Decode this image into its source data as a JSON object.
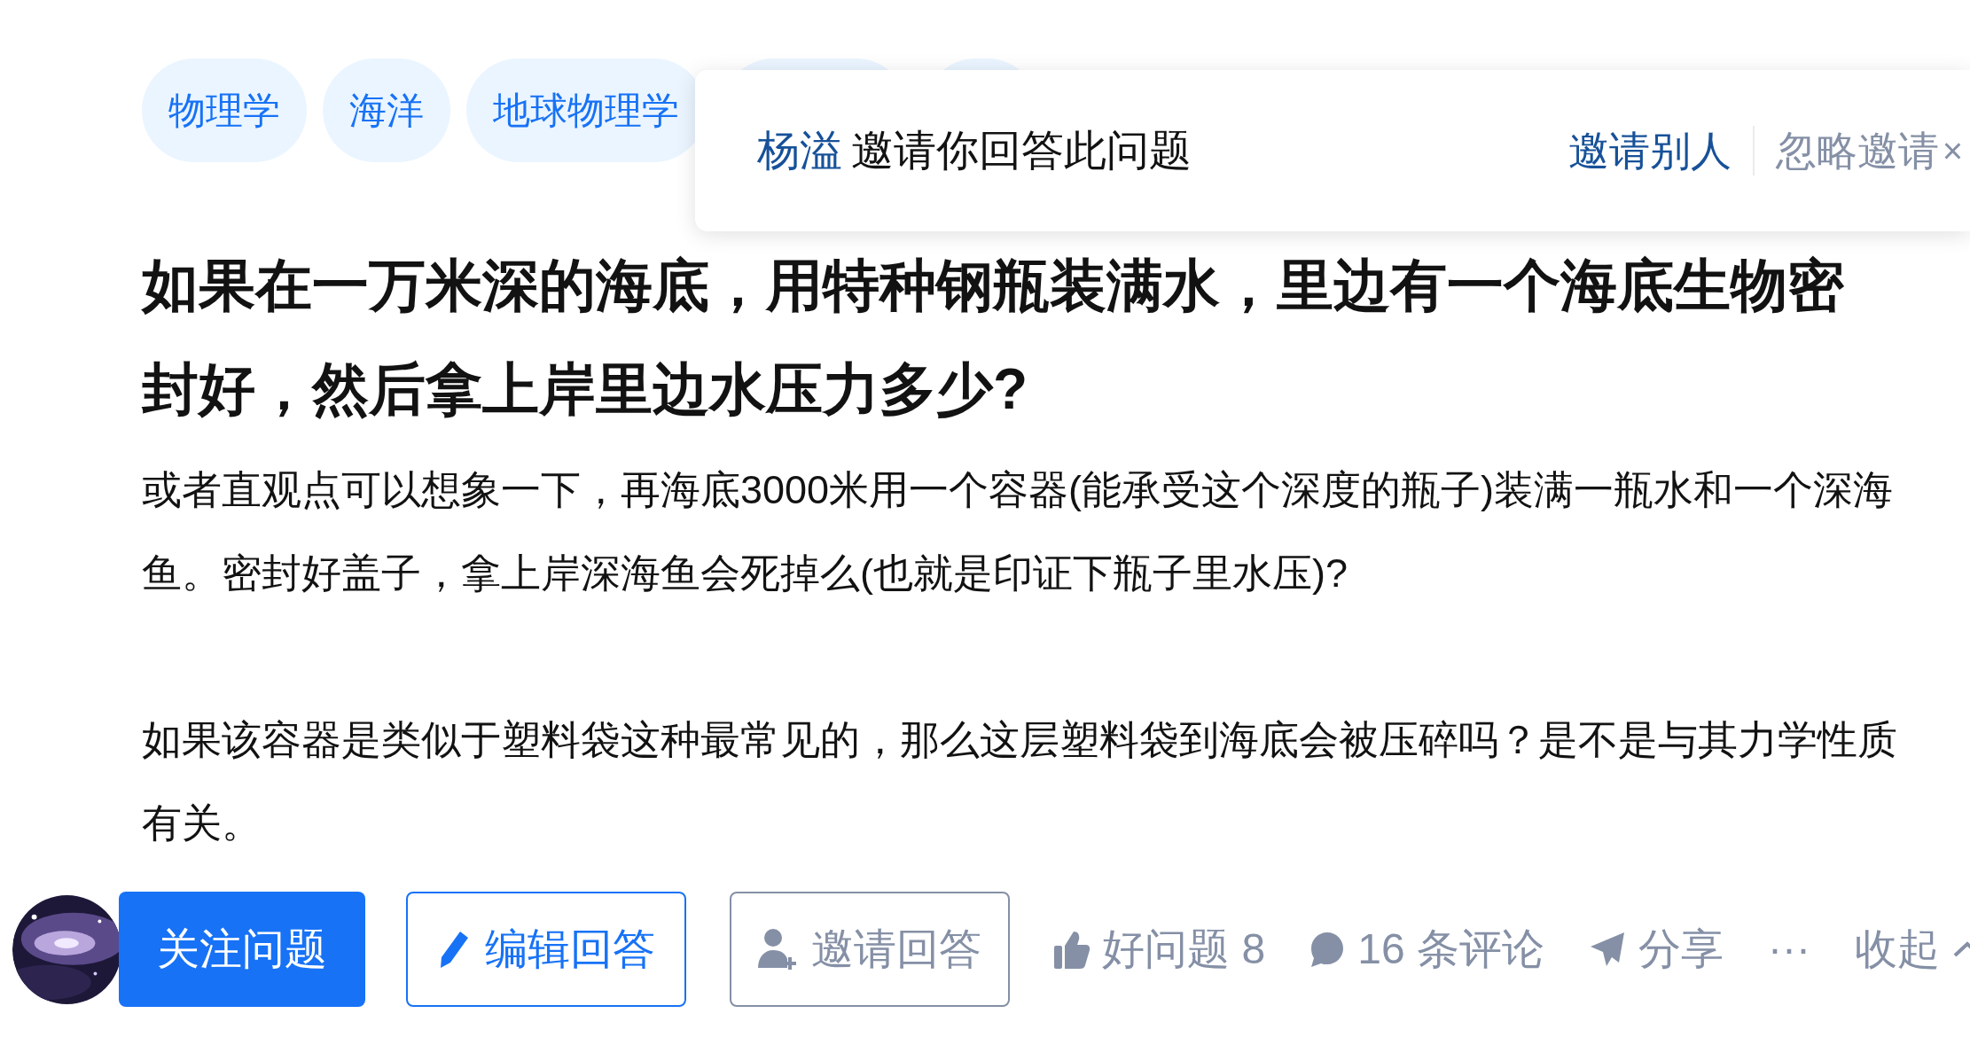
{
  "tags": [
    {
      "label": "物理学"
    },
    {
      "label": "海洋"
    },
    {
      "label": "地球物理学"
    }
  ],
  "invite_popup": {
    "inviter": "杨溢",
    "message": "邀请你回答此问题",
    "invite_others": "邀请别人",
    "ignore": "忽略邀请",
    "close": "×"
  },
  "question": {
    "title": "如果在一万米深的海底，用特种钢瓶装满水，里边有一个海底生物密封好，然后拿上岸里边水压力多少?",
    "description": [
      "或者直观点可以想象一下，再海底3000米用一个容器(能承受这个深度的瓶子)装满一瓶水和一个深海鱼。密封好盖子，拿上岸深海鱼会死掉么(也就是印证下瓶子里水压)?",
      "如果该容器是类似于塑料袋这种最常见的，那么这层塑料袋到海底会被压碎吗？是不是与其力学性质有关。"
    ]
  },
  "actions": [
    {
      "kind": "primary",
      "label": "关注问题"
    },
    {
      "kind": "outline-blue",
      "label": "编辑回答"
    },
    {
      "kind": "outline-gray",
      "label": "邀请回答"
    },
    {
      "kind": "text",
      "label": "好问题 8"
    },
    {
      "kind": "text",
      "label": "16 条评论"
    },
    {
      "kind": "text",
      "label": "分享"
    },
    {
      "kind": "text",
      "label": "···"
    },
    {
      "kind": "text",
      "label": "收起"
    }
  ]
}
